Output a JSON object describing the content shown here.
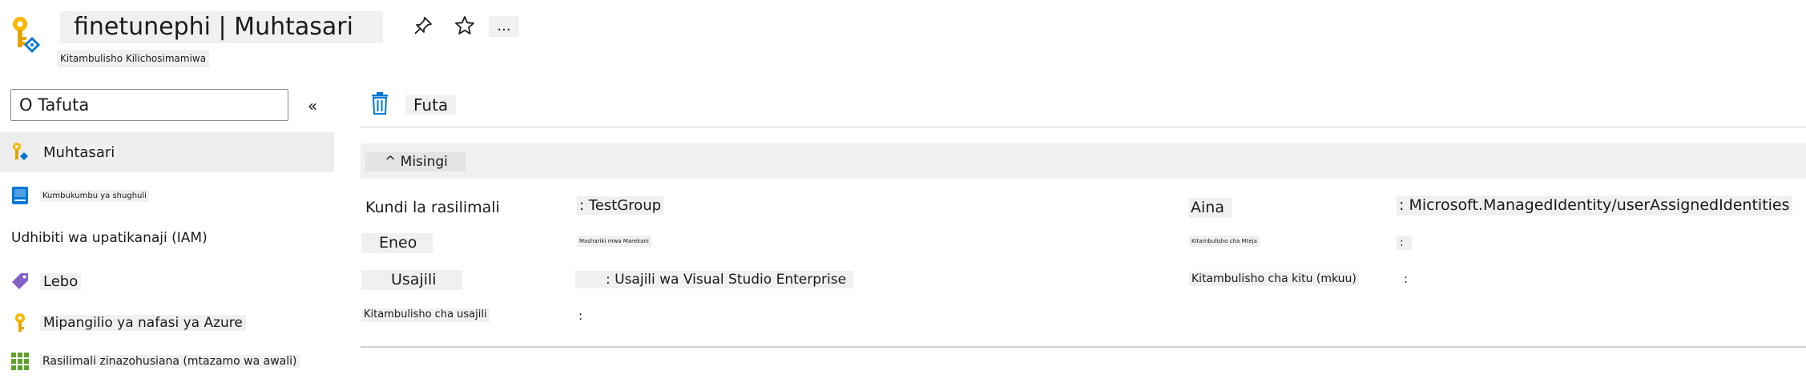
{
  "header": {
    "title": "finetunephi | Muhtasari",
    "subtitle": "Kitambulisho Kilichosimamiwa",
    "pin_icon": "pin-icon",
    "star_icon": "star-icon",
    "more_label": "..."
  },
  "search": {
    "value": "O Tafuta",
    "collapse_label": "«"
  },
  "sidebar": {
    "items": [
      {
        "label": "Muhtasari",
        "icon": "managed-identity-icon",
        "selected": true
      },
      {
        "label": "Kumbukumbu ya shughuli",
        "icon": "activity-log-icon"
      },
      {
        "label": "Udhibiti wa upatikanaji (IAM)"
      },
      {
        "label": "Lebo",
        "icon": "tag-icon"
      },
      {
        "label": "Mipangilio ya nafasi ya Azure",
        "icon": "key-icon"
      },
      {
        "label": "Rasilimali zinazohusiana (mtazamo wa awali)",
        "icon": "grid-icon"
      }
    ]
  },
  "toolbar": {
    "delete_label": "Futa"
  },
  "essentials": {
    "section_label": "^ Misingi",
    "resource_group_label": "Kundi la rasilimali",
    "resource_group_value": ": TestGroup",
    "location_label": "Eneo",
    "location_value": "Mashariki mwa Marekani",
    "subscription_label": "Usajili",
    "subscription_value": ": Usajili wa Visual Studio Enterprise",
    "subscription_id_label": "Kitambulisho cha usajili",
    "subscription_id_value": ":",
    "type_label": "Aina",
    "type_value": ": Microsoft.ManagedIdentity/userAssignedIdentities",
    "client_id_label": "Kitambulisho cha Mteja",
    "client_id_value": ":",
    "object_id_label": "Kitambulisho cha kitu (mkuu)",
    "object_id_value": ":"
  },
  "colors": {
    "accent": "#0078d4",
    "key_gold": "#f5b900",
    "tag_purple": "#8661c5",
    "grid_green": "#5ea12b"
  }
}
